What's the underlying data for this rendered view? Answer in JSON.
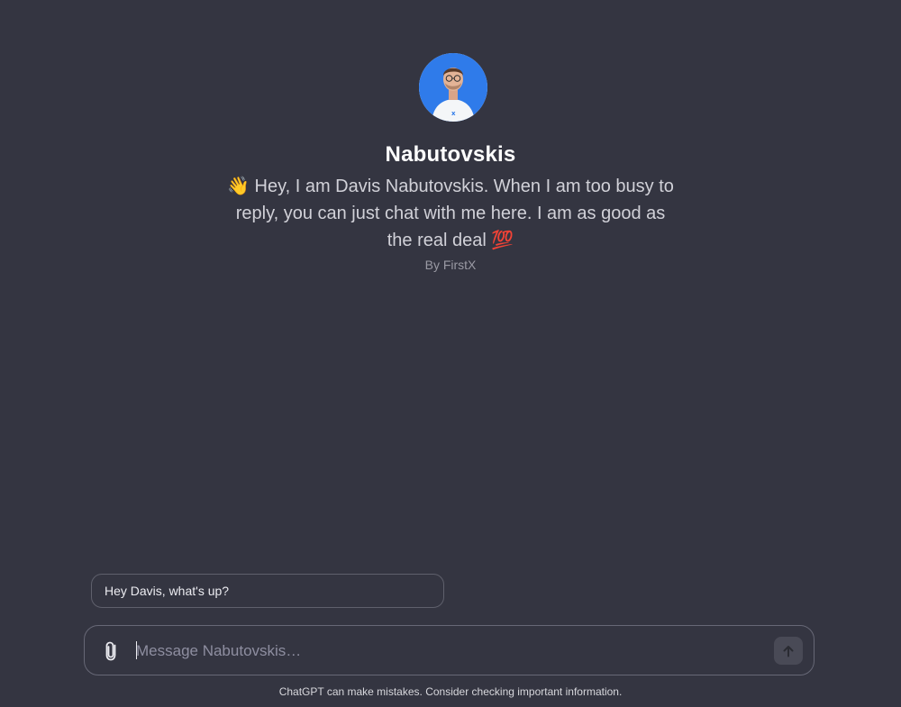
{
  "gpt": {
    "name": "Nabutovskis",
    "description": "👋 Hey, I am Davis Nabutovskis. When I am too busy to reply, you can just chat with me here. I am as good as the real deal 💯",
    "author": "By FirstX",
    "avatar_icon": "profile-photo"
  },
  "suggestions": [
    {
      "label": "Hey Davis, what's up?"
    }
  ],
  "composer": {
    "placeholder": "Message Nabutovskis…",
    "value": "",
    "attach_icon": "paperclip-icon",
    "send_icon": "arrow-up-icon"
  },
  "footer": {
    "disclaimer": "ChatGPT can make mistakes. Consider checking important information."
  },
  "colors": {
    "background": "#343541",
    "avatar_bg": "#2f7bea",
    "border": "#676876",
    "send_button_bg": "#494a56"
  }
}
